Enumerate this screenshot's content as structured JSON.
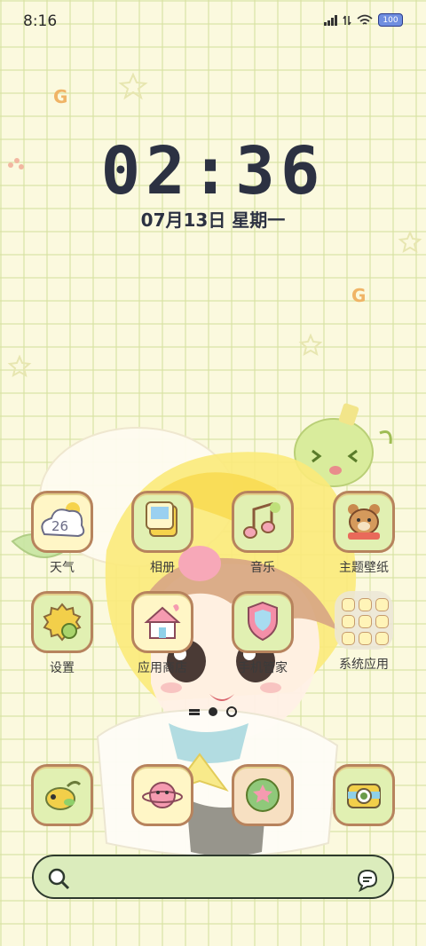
{
  "status_bar": {
    "time": "8:16",
    "battery": "100"
  },
  "clock": {
    "time": "02:36",
    "date": "07月13日 星期一"
  },
  "apps_row1": [
    {
      "label": "天气",
      "icon": "weather-icon",
      "temp": "26"
    },
    {
      "label": "相册",
      "icon": "gallery-icon"
    },
    {
      "label": "音乐",
      "icon": "music-icon"
    },
    {
      "label": "主题壁纸",
      "icon": "theme-icon"
    }
  ],
  "apps_row2": [
    {
      "label": "设置",
      "icon": "settings-icon"
    },
    {
      "label": "应用商店",
      "icon": "app-store-icon"
    },
    {
      "label": "手机管家",
      "icon": "phone-manager-icon"
    },
    {
      "label": "系统应用",
      "icon": "folder-icon"
    }
  ],
  "dock": [
    {
      "icon": "dinosaur-icon"
    },
    {
      "icon": "planet-icon"
    },
    {
      "icon": "star-icon"
    },
    {
      "icon": "camera-icon"
    }
  ],
  "colors": {
    "background": "#fbf9de",
    "icon_border": "#b7835d",
    "search_bar": "#dbecbc",
    "text": "#2c3142"
  }
}
